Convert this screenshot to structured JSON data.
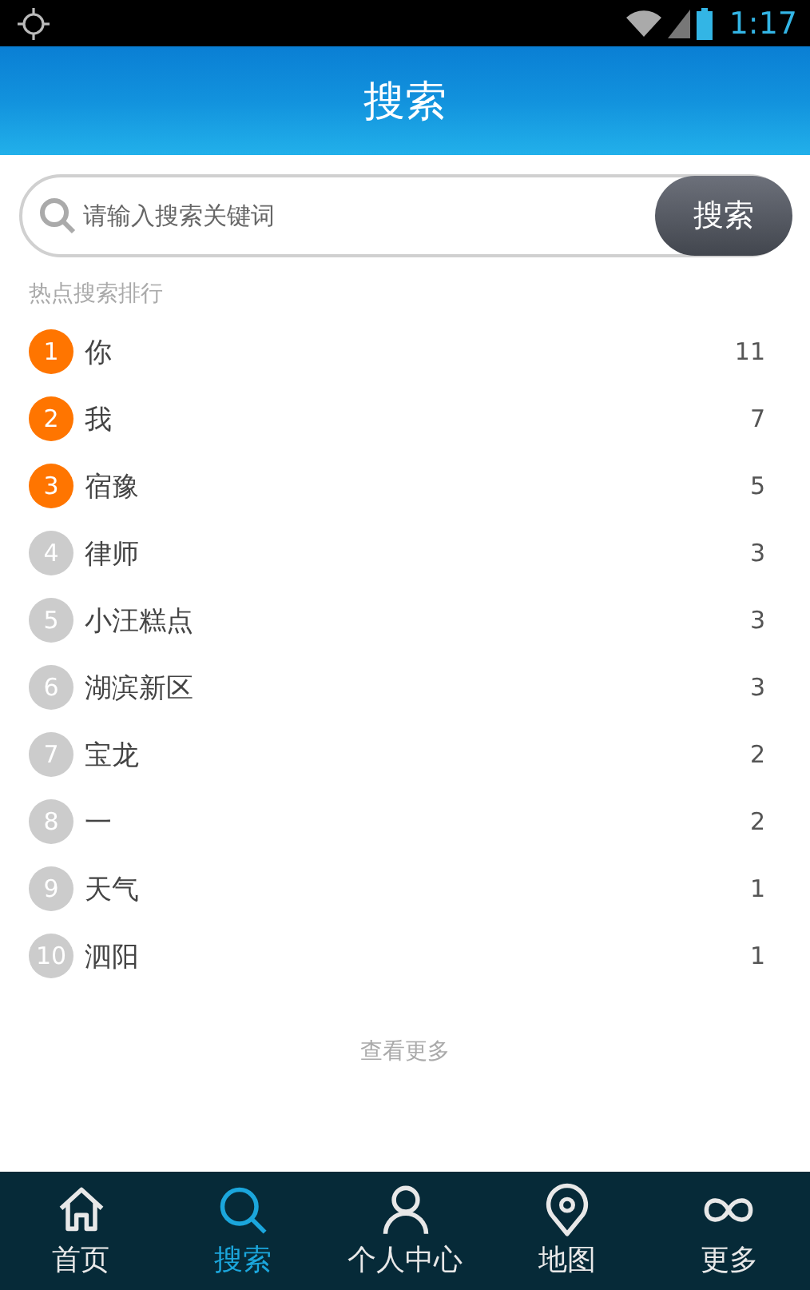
{
  "status_bar": {
    "time": "1:17"
  },
  "header": {
    "title": "搜索"
  },
  "search": {
    "placeholder": "请输入搜索关键词",
    "button": "搜索"
  },
  "hot_section": {
    "title": "热点搜索排行"
  },
  "hot_items": [
    {
      "rank": "1",
      "text": "你",
      "count": "11",
      "color": "#ff7500"
    },
    {
      "rank": "2",
      "text": "我",
      "count": "7",
      "color": "#ff7500"
    },
    {
      "rank": "3",
      "text": "宿豫",
      "count": "5",
      "color": "#ff7500"
    },
    {
      "rank": "4",
      "text": "律师",
      "count": "3",
      "color": "#cccccc"
    },
    {
      "rank": "5",
      "text": "小汪糕点",
      "count": "3",
      "color": "#cccccc"
    },
    {
      "rank": "6",
      "text": "湖滨新区",
      "count": "3",
      "color": "#cccccc"
    },
    {
      "rank": "7",
      "text": "宝龙",
      "count": "2",
      "color": "#cccccc"
    },
    {
      "rank": "8",
      "text": "一",
      "count": "2",
      "color": "#cccccc"
    },
    {
      "rank": "9",
      "text": "天气",
      "count": "1",
      "color": "#cccccc"
    },
    {
      "rank": "10",
      "text": "泗阳",
      "count": "1",
      "color": "#cccccc"
    }
  ],
  "more_link": "查看更多",
  "tabs": [
    {
      "label": "首页",
      "kind": "home",
      "selected": false
    },
    {
      "label": "搜索",
      "kind": "search",
      "selected": true
    },
    {
      "label": "个人中心",
      "kind": "person",
      "selected": false
    },
    {
      "label": "地图",
      "kind": "map",
      "selected": false
    },
    {
      "label": "更多",
      "kind": "more",
      "selected": false
    }
  ]
}
